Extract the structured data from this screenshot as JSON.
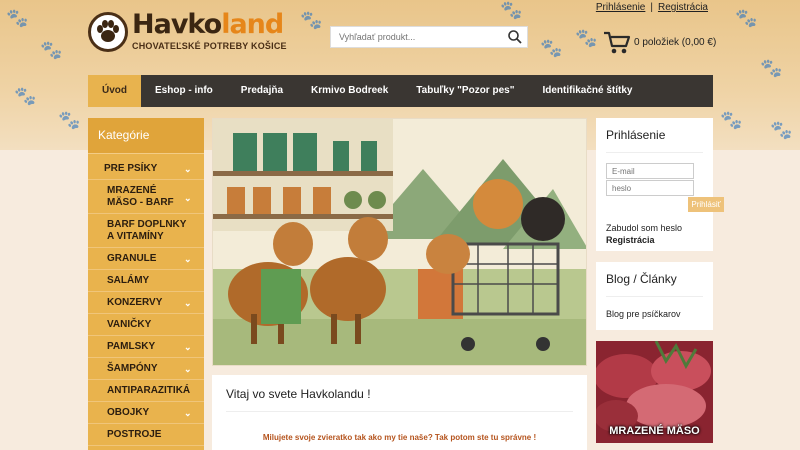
{
  "header": {
    "logo_name_part1": "Havko",
    "logo_name_part2": "land",
    "logo_subtitle": "CHOVATEĽSKÉ POTREBY KOŠICE",
    "login_link": "Prihlásenie",
    "register_link": "Registrácia",
    "search_placeholder": "Vyhľadať produkt...",
    "cart_text": "0 položiek (0,00 €)"
  },
  "nav": {
    "items": [
      {
        "label": "Úvod"
      },
      {
        "label": "Eshop - info"
      },
      {
        "label": "Predajňa"
      },
      {
        "label": "Krmivo Bodreek"
      },
      {
        "label": "Tabuľky \"Pozor pes\""
      },
      {
        "label": "Identifikačné štítky"
      }
    ]
  },
  "categories": {
    "title": "Kategórie",
    "top": "PRE PSÍKY",
    "items": [
      {
        "label_line1": "MRAZENÉ",
        "label_line2": "MÄSO - BARF"
      },
      {
        "label_line1": "BARF DOPLNKY",
        "label_line2": "A VITAMÍNY"
      },
      {
        "label": "GRANULE"
      },
      {
        "label": "SALÁMY"
      },
      {
        "label": "KONZERVY"
      },
      {
        "label": "VANIČKY"
      },
      {
        "label": "PAMLSKY"
      },
      {
        "label": "ŠAMPÓNY"
      },
      {
        "label": "ANTIPARAZITIKÁ"
      },
      {
        "label": "OBOJKY"
      },
      {
        "label": "POSTROJE"
      }
    ]
  },
  "welcome": {
    "title": "Vitaj vo svete Havkolandu !",
    "text": "Milujete svoje zvieratko tak ako my tie naše? Tak potom ste tu správne !"
  },
  "login_box": {
    "title": "Prihlásenie",
    "email_placeholder": "E-mail",
    "password_placeholder": "heslo",
    "submit_label": "Prihlásiť",
    "forgot_text": "Zabudol som heslo",
    "register_text": "Registrácia"
  },
  "blog_box": {
    "title": "Blog / Články",
    "link": "Blog pre psíčkarov"
  },
  "promo": {
    "label": "MRAZENÉ MÄSO"
  },
  "colors": {
    "accent": "#e8b34e",
    "nav_bg": "#3a3632",
    "brand_orange": "#e6861a",
    "brand_brown": "#3b2612"
  }
}
